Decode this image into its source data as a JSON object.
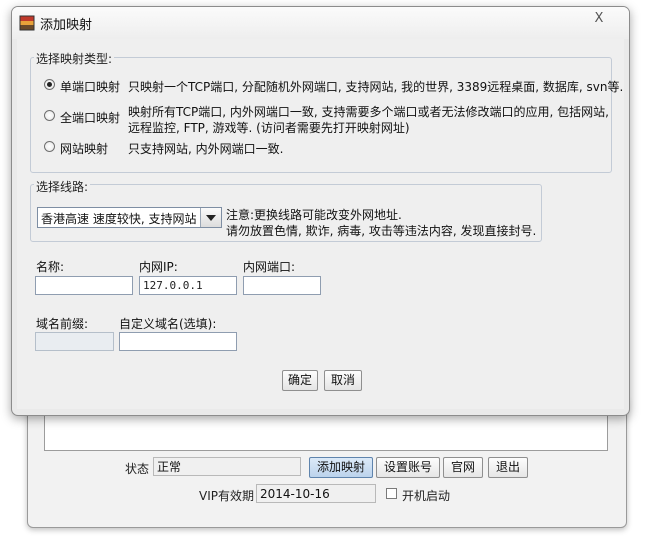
{
  "dialog": {
    "title": "添加映射",
    "close_label": "X",
    "mapping_type": {
      "legend": "选择映射类型:",
      "options": [
        {
          "label": "单端口映射",
          "desc": "只映射一个TCP端口, 分配随机外网端口, 支持网站, 我的世界, 3389远程桌面, 数据库, svn等.",
          "checked": true
        },
        {
          "label": "全端口映射",
          "desc_line1": "映射所有TCP端口, 内外网端口一致, 支持需要多个端口或者无法修改端口的应用, 包括网站,",
          "desc_line2": "远程监控, FTP, 游戏等. (访问者需要先打开映射网址)",
          "checked": false
        },
        {
          "label": "网站映射",
          "desc": "只支持网站, 内外网端口一致.",
          "checked": false
        }
      ]
    },
    "route": {
      "legend": "选择线路:",
      "selected": "香港高速  速度较快, 支持网站",
      "note_line1": "注意:更换线路可能改变外网地址.",
      "note_line2": "请勿放置色情, 欺诈, 病毒, 攻击等违法内容, 发现直接封号."
    },
    "fields": {
      "name_label": "名称:",
      "name_value": "",
      "ip_label": "内网IP:",
      "ip_value": "127.0.0.1",
      "port_label": "内网端口:",
      "port_value": "",
      "prefix_label": "域名前缀:",
      "prefix_value": "",
      "custom_label": "自定义域名(选填):",
      "custom_value": ""
    },
    "buttons": {
      "ok": "确定",
      "cancel": "取消"
    }
  },
  "main_window": {
    "status_label": "状态",
    "status_value": "正常",
    "buttons": {
      "add_mapping": "添加映射",
      "account": "设置账号",
      "website": "官网",
      "exit": "退出"
    },
    "vip_label": "VIP有效期",
    "vip_value": "2014-10-16",
    "autostart_label": "开机启动",
    "autostart_checked": false
  }
}
